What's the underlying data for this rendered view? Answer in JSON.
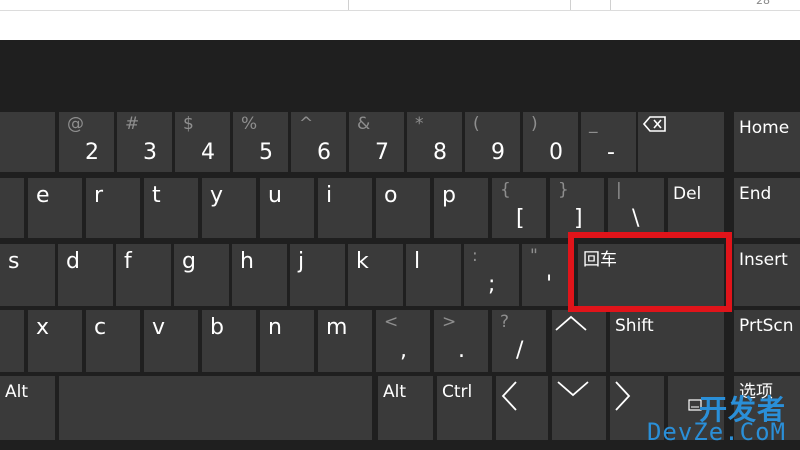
{
  "top_bar": {
    "corner_text": "28"
  },
  "keyboard": {
    "row1": [
      {
        "name": "key-2",
        "sub": "@",
        "main": "2"
      },
      {
        "name": "key-3",
        "sub": "#",
        "main": "3"
      },
      {
        "name": "key-4",
        "sub": "$",
        "main": "4"
      },
      {
        "name": "key-5",
        "sub": "%",
        "main": "5"
      },
      {
        "name": "key-6",
        "sub": "^",
        "main": "6"
      },
      {
        "name": "key-7",
        "sub": "&",
        "main": "7"
      },
      {
        "name": "key-8",
        "sub": "*",
        "main": "8"
      },
      {
        "name": "key-9",
        "sub": "(",
        "main": "9"
      },
      {
        "name": "key-0",
        "sub": ")",
        "main": "0"
      },
      {
        "name": "key-minus",
        "sub": "_",
        "main": "-"
      },
      {
        "name": "key-equals",
        "sub": "+",
        "main": "="
      }
    ],
    "row2": [
      {
        "name": "key-e",
        "main": "e"
      },
      {
        "name": "key-r",
        "main": "r"
      },
      {
        "name": "key-t",
        "main": "t"
      },
      {
        "name": "key-y",
        "main": "y"
      },
      {
        "name": "key-u",
        "main": "u"
      },
      {
        "name": "key-i",
        "main": "i"
      },
      {
        "name": "key-o",
        "main": "o"
      },
      {
        "name": "key-p",
        "main": "p"
      },
      {
        "name": "key-left-bracket",
        "sub": "{",
        "main": "["
      },
      {
        "name": "key-right-bracket",
        "sub": "}",
        "main": "]"
      },
      {
        "name": "key-backslash",
        "sub": "|",
        "main": "\\"
      }
    ],
    "row3": [
      {
        "name": "key-s",
        "main": "s"
      },
      {
        "name": "key-d",
        "main": "d"
      },
      {
        "name": "key-f",
        "main": "f"
      },
      {
        "name": "key-g",
        "main": "g"
      },
      {
        "name": "key-h",
        "main": "h"
      },
      {
        "name": "key-j",
        "main": "j"
      },
      {
        "name": "key-k",
        "main": "k"
      },
      {
        "name": "key-l",
        "main": "l"
      },
      {
        "name": "key-semicolon",
        "sub": ":",
        "main": ";"
      },
      {
        "name": "key-quote",
        "sub": "\"",
        "main": "'"
      }
    ],
    "row4": [
      {
        "name": "key-x",
        "main": "x"
      },
      {
        "name": "key-c",
        "main": "c"
      },
      {
        "name": "key-v",
        "main": "v"
      },
      {
        "name": "key-b",
        "main": "b"
      },
      {
        "name": "key-n",
        "main": "n"
      },
      {
        "name": "key-m",
        "main": "m"
      },
      {
        "name": "key-comma",
        "sub": "<",
        "main": ","
      },
      {
        "name": "key-period",
        "sub": ">",
        "main": "."
      },
      {
        "name": "key-slash",
        "sub": "?",
        "main": "/"
      }
    ],
    "enter_label": "回车",
    "shift_label": "Shift",
    "del_label": "Del",
    "home_label": "Home",
    "end_label": "End",
    "insert_label": "Insert",
    "prtscn_label": "PrtScn",
    "alt_label": "Alt",
    "alt_right_label": "Alt",
    "ctrl_label": "Ctrl",
    "options_label": "选项"
  },
  "watermark": {
    "line1": "开发者",
    "line2": "DevZe.CoM"
  },
  "colors": {
    "key_bg": "#3a3a3a",
    "panel_bg": "#1f1f1f",
    "highlight": "#e0141a",
    "watermark": "#2a8fd8"
  }
}
